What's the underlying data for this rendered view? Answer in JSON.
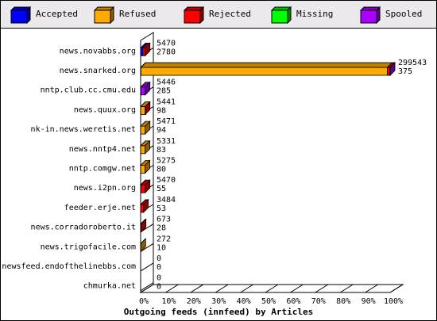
{
  "colors": {
    "Accepted": "#0000ff",
    "Refused": "#ffaa00",
    "Rejected": "#ff0000",
    "Missing": "#00ff00",
    "Spooled": "#aa00ff",
    "background": "#ffffff",
    "legend_bg": "#ece9ec"
  },
  "legend": [
    {
      "name": "Accepted",
      "icon": "blue-cube-icon"
    },
    {
      "name": "Refused",
      "icon": "orange-cube-icon"
    },
    {
      "name": "Rejected",
      "icon": "red-cube-icon"
    },
    {
      "name": "Missing",
      "icon": "green-cube-icon"
    },
    {
      "name": "Spooled",
      "icon": "purple-cube-icon"
    }
  ],
  "chart_data": {
    "type": "bar",
    "orientation": "horizontal",
    "stacked": true,
    "style": "3d",
    "title": "Outgoing feeds (innfeed) by Articles",
    "xlabel": "",
    "ylabel": "",
    "xlim": [
      0,
      100
    ],
    "xticks": [
      "0%",
      "10%",
      "20%",
      "30%",
      "40%",
      "50%",
      "60%",
      "70%",
      "80%",
      "90%",
      "100%"
    ],
    "categories": [
      "news.novabbs.org",
      "news.snarked.org",
      "nntp.club.cc.cmu.edu",
      "news.quux.org",
      "nk-in.news.weretis.net",
      "news.nntp4.net",
      "nntp.comgw.net",
      "news.i2pn.org",
      "feeder.erje.net",
      "news.corradoroberto.it",
      "news.trigofacile.com",
      "newsfeed.endofthelinebbs.com",
      "chmurka.net"
    ],
    "offered_labels": [
      "5470",
      "299543",
      "5446",
      "5441",
      "5471",
      "5331",
      "5275",
      "5470",
      "3484",
      "673",
      "272",
      "0",
      "0"
    ],
    "accepted_labels": [
      "2780",
      "375",
      "285",
      "98",
      "94",
      "83",
      "80",
      "55",
      "53",
      "28",
      "10",
      "0",
      "0"
    ],
    "series": [
      {
        "name": "Accepted",
        "values": [
          0.93,
          0.13,
          0.1,
          0.03,
          0.03,
          0.03,
          0.03,
          0.02,
          0.02,
          0.01,
          0.0,
          0,
          0
        ]
      },
      {
        "name": "Refused",
        "values": [
          0.0,
          98.73,
          0.0,
          1.79,
          1.79,
          1.75,
          1.73,
          0.14,
          0.0,
          0.0,
          0.09,
          0,
          0
        ]
      },
      {
        "name": "Rejected",
        "values": [
          0.89,
          1.0,
          0.0,
          0.02,
          0.0,
          0.0,
          0.0,
          1.65,
          1.14,
          0.21,
          0.0,
          0,
          0
        ]
      },
      {
        "name": "Missing",
        "values": [
          0,
          0,
          0,
          0,
          0,
          0,
          0,
          0,
          0,
          0,
          0,
          0,
          0
        ]
      },
      {
        "name": "Spooled",
        "values": [
          0.0,
          0.14,
          1.72,
          0.0,
          0.0,
          0.0,
          0.0,
          0.0,
          0.0,
          0.0,
          0.0,
          0,
          0
        ]
      }
    ],
    "grid": false,
    "legend_position": "top"
  }
}
